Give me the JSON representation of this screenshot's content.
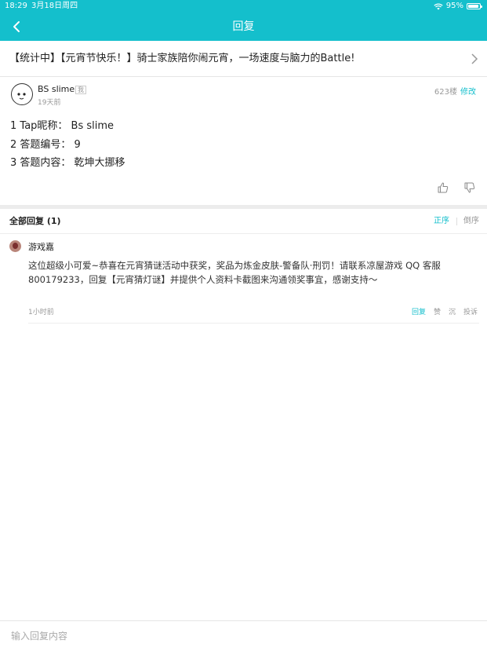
{
  "status": {
    "time": "18:29",
    "date": "3月18日周四",
    "battery": "95%"
  },
  "nav": {
    "title": "回复"
  },
  "topic": {
    "title": "【统计中】【元宵节快乐！】骑士家族陪你闹元宵，一场速度与脑力的Battle!"
  },
  "post": {
    "author": "BS slime",
    "me_tag": "我",
    "time_ago": "19天前",
    "floor": "623楼",
    "edit_label": "修改",
    "lines": [
      "1 Tap昵称：  Bs slime",
      "2 答题编号：  9",
      "3 答题内容：  乾坤大挪移"
    ]
  },
  "replies_header": {
    "label": "全部回复 (1)",
    "asc": "正序",
    "desc": "倒序"
  },
  "reply": {
    "author": "游戏嘉",
    "text": "这位超级小可爱~恭喜在元宵猜谜活动中获奖，奖品为炼金皮肤-警备队·刑罚！请联系凉屋游戏 QQ 客服800179233，回复【元宵猜灯谜】并提供个人资料卡截图来沟通领奖事宜，感谢支持～",
    "time": "1小时前",
    "actions": {
      "reply": "回复",
      "like": "赞",
      "sink": "沉",
      "report": "投诉"
    }
  },
  "input": {
    "placeholder": "输入回复内容"
  },
  "colors": {
    "accent": "#14bfcc",
    "divider": "#ececec"
  }
}
